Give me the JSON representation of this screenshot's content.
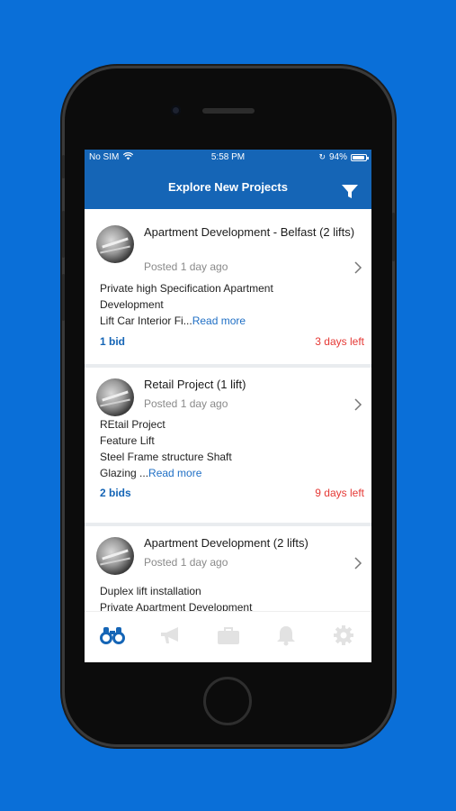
{
  "status": {
    "carrier": "No SIM",
    "time": "5:58 PM",
    "battery": "94%"
  },
  "header": {
    "title": "Explore New Projects",
    "filter_icon": "filter-icon"
  },
  "projects": [
    {
      "title": "Apartment Development - Belfast (2 lifts)",
      "posted": "Posted 1 day ago",
      "desc_lines": [
        "Private high Specification Apartment",
        "Development"
      ],
      "desc_truncated": "Lift Car Interior Fi...",
      "read_more": "Read more",
      "bids": "1 bid",
      "days_left": "3 days left"
    },
    {
      "title": "Retail Project (1 lift)",
      "posted": "Posted 1 day ago",
      "desc_lines": [
        "REtail Project",
        "Feature Lift",
        "Steel Frame structure Shaft"
      ],
      "desc_truncated": "Glazing ...",
      "read_more": "Read more",
      "bids": "2 bids",
      "days_left": "9 days left"
    },
    {
      "title": "Apartment Development (2 lifts)",
      "posted": "Posted 1 day ago",
      "desc_lines": [
        "Duplex lift installation",
        "Private Apartment Development"
      ]
    }
  ],
  "tabs": [
    "binoculars-icon",
    "megaphone-icon",
    "briefcase-icon",
    "bell-icon",
    "gear-icon"
  ],
  "colors": {
    "background": "#0a6fd8",
    "header": "#1565b6",
    "accent": "#1f6fc5",
    "alert": "#e53935"
  }
}
